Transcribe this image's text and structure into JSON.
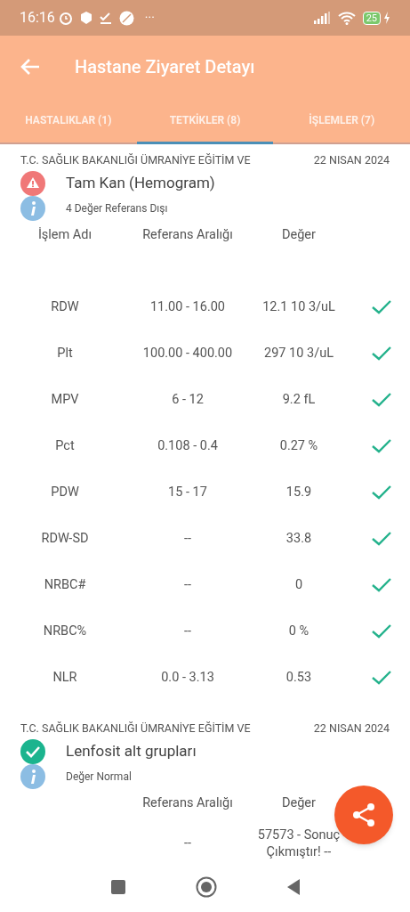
{
  "status_bar": {
    "time": "16:16",
    "more": "···",
    "battery": "25"
  },
  "app_bar": {
    "title": "Hastane Ziyaret Detayı"
  },
  "tabs": [
    {
      "label": "HASTALIKLAR (1)",
      "selected": false
    },
    {
      "label": "TETKİKLER (8)",
      "selected": true
    },
    {
      "label": "İŞLEMLER (7)",
      "selected": false
    }
  ],
  "tests": [
    {
      "hospital": "T.C. SAĞLIK BAKANLIĞI ÜMRANİYE EĞİTİM VE",
      "date": "22 NISAN 2024",
      "name": "Tam Kan (Hemogram)",
      "kind": "warning",
      "info": "4 Değer Referans Dışı",
      "columns": [
        "İşlem Adı",
        "Referans Aralığı",
        "Değer"
      ],
      "rows": [
        {
          "name": "RDW",
          "range": "11.00 - 16.00",
          "value": "12.1 10 3/uL",
          "normal": true
        },
        {
          "name": "Plt",
          "range": "100.00 - 400.00",
          "value": "297 10 3/uL",
          "normal": true
        },
        {
          "name": "MPV",
          "range": "6 - 12",
          "value": "9.2 fL",
          "normal": true
        },
        {
          "name": "Pct",
          "range": "0.108 - 0.4",
          "value": "0.27 %",
          "normal": true
        },
        {
          "name": "PDW",
          "range": "15 - 17",
          "value": "15.9",
          "normal": true
        },
        {
          "name": "RDW-SD",
          "range": "--",
          "value": "33.8",
          "normal": true
        },
        {
          "name": "NRBC#",
          "range": "--",
          "value": "0",
          "normal": true
        },
        {
          "name": "NRBC%",
          "range": "--",
          "value": "0 %",
          "normal": true
        },
        {
          "name": "NLR",
          "range": "0.0 - 3.13",
          "value": "0.53",
          "normal": true
        }
      ]
    },
    {
      "hospital": "T.C. SAĞLIK BAKANLIĞI ÜMRANİYE EĞİTİM VE",
      "date": "22 NISAN 2024",
      "name": "Lenfosit alt grupları",
      "kind": "ok",
      "info": "Değer Normal",
      "columns": [
        "Referans Aralığı",
        "Değer"
      ],
      "rows": [
        {
          "range": "--",
          "value": "57573 - Sonuç Çıkmıştır! --"
        }
      ]
    }
  ]
}
